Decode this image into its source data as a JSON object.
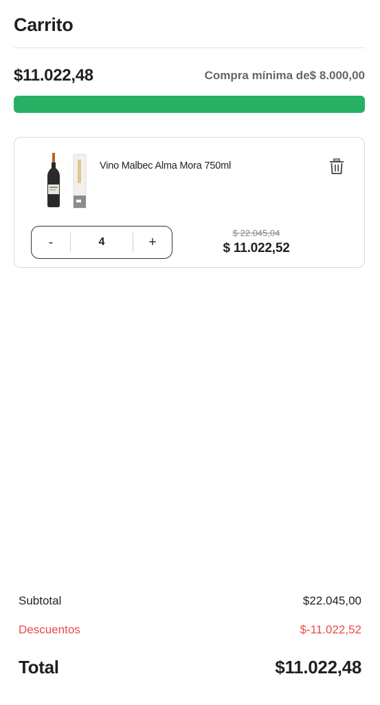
{
  "header": {
    "title": "Carrito"
  },
  "progress": {
    "current_amount": "$11.022,48",
    "min_purchase_label": "Compra mínima de$ 8.000,00",
    "fill_fraction": 1.0,
    "color": "#27b064"
  },
  "cart": {
    "items": [
      {
        "name": "Vino Malbec Alma Mora 750ml",
        "quantity": "4",
        "decrement_label": "-",
        "increment_label": "+",
        "original_price": "$ 22.045,04",
        "price": "$ 11.022,52",
        "image_icon": "wine-bottle-icon",
        "remove_icon": "trash-icon"
      }
    ]
  },
  "summary": {
    "subtotal_label": "Subtotal",
    "subtotal_value": "$22.045,00",
    "discount_label": "Descuentos",
    "discount_value": "$-11.022,52",
    "discount_color": "#ea4a45",
    "total_label": "Total",
    "total_value": "$11.022,48"
  }
}
